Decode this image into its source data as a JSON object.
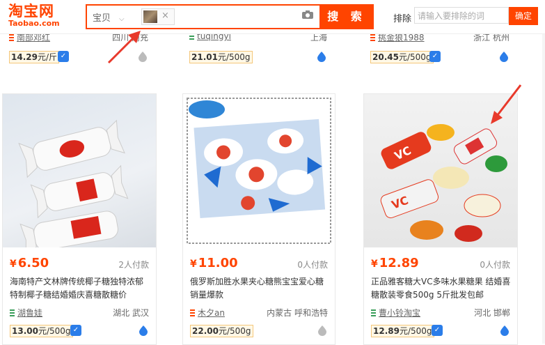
{
  "header": {
    "logo_cn": "淘宝网",
    "logo_en": "Taobao.com",
    "category": "宝贝",
    "search_button": "搜 索",
    "exclude_label": "排除",
    "exclude_placeholder": "请输入要排除的词",
    "exclude_button": "确定"
  },
  "top_row": [
    {
      "shop": "南部邓红",
      "location": "四川 南充",
      "per_weight": "14.29",
      "unit": "元/斤"
    },
    {
      "shop": "tuqingyi",
      "location": "上海",
      "per_weight": "21.01",
      "unit": "元/500g"
    },
    {
      "shop": "挑金狼1988",
      "location": "浙江 杭州",
      "per_weight": "20.45",
      "unit": "元/500g"
    }
  ],
  "products": [
    {
      "price": "6.50",
      "paid": "2人付款",
      "title": "海南特产文林牌传统椰子糖独特浓郁特制椰子糖结婚婚庆喜糖散糖价",
      "shop": "湖鲁娃",
      "location": "湖北 武汉",
      "per_weight": "13.00",
      "unit": "元/500g"
    },
    {
      "price": "11.00",
      "paid": "0人付款",
      "title": "俄罗斯加胜水果夹心糖熊宝宝爱心糖销量爆款",
      "shop": "木夕an",
      "location": "内蒙古 呼和浩特",
      "per_weight": "22.00",
      "unit": "元/500g"
    },
    {
      "price": "12.89",
      "paid": "0人付款",
      "title": "正品雅客糖大VC多味水果糖果 结婚喜糖散装零食500g 5斤批发包邮",
      "shop": "曹小铃淘宝",
      "location": "河北 邯郸",
      "per_weight": "12.89",
      "unit": "元/500g"
    }
  ],
  "currency": "¥",
  "colors": {
    "accent": "#ff4400",
    "badge": "#2b7de9",
    "arrow": "#e8392b"
  }
}
